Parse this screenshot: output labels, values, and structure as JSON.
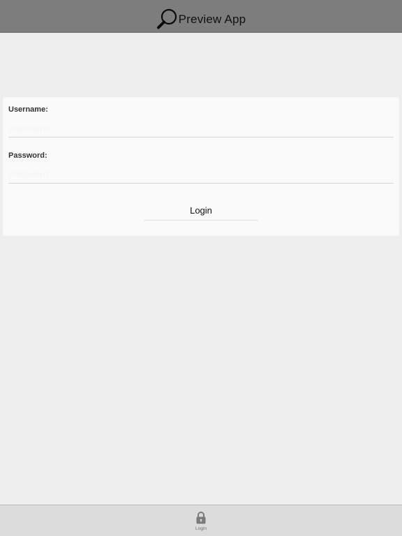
{
  "header": {
    "title": "Preview App",
    "logo_icon": "magnifier-icon"
  },
  "form": {
    "username": {
      "label": "Username:",
      "value": "",
      "placeholder": "Username"
    },
    "password": {
      "label": "Password:",
      "value": "",
      "placeholder": "Password"
    },
    "login_button": "Login"
  },
  "tabbar": {
    "items": [
      {
        "label": "Login",
        "icon": "lock-icon",
        "selected": true
      }
    ]
  },
  "colors": {
    "header_bg": "#7d7d7d",
    "page_bg": "#eeeeee",
    "card_bg": "#fafafa",
    "tabbar_bg": "#dddcdd"
  }
}
